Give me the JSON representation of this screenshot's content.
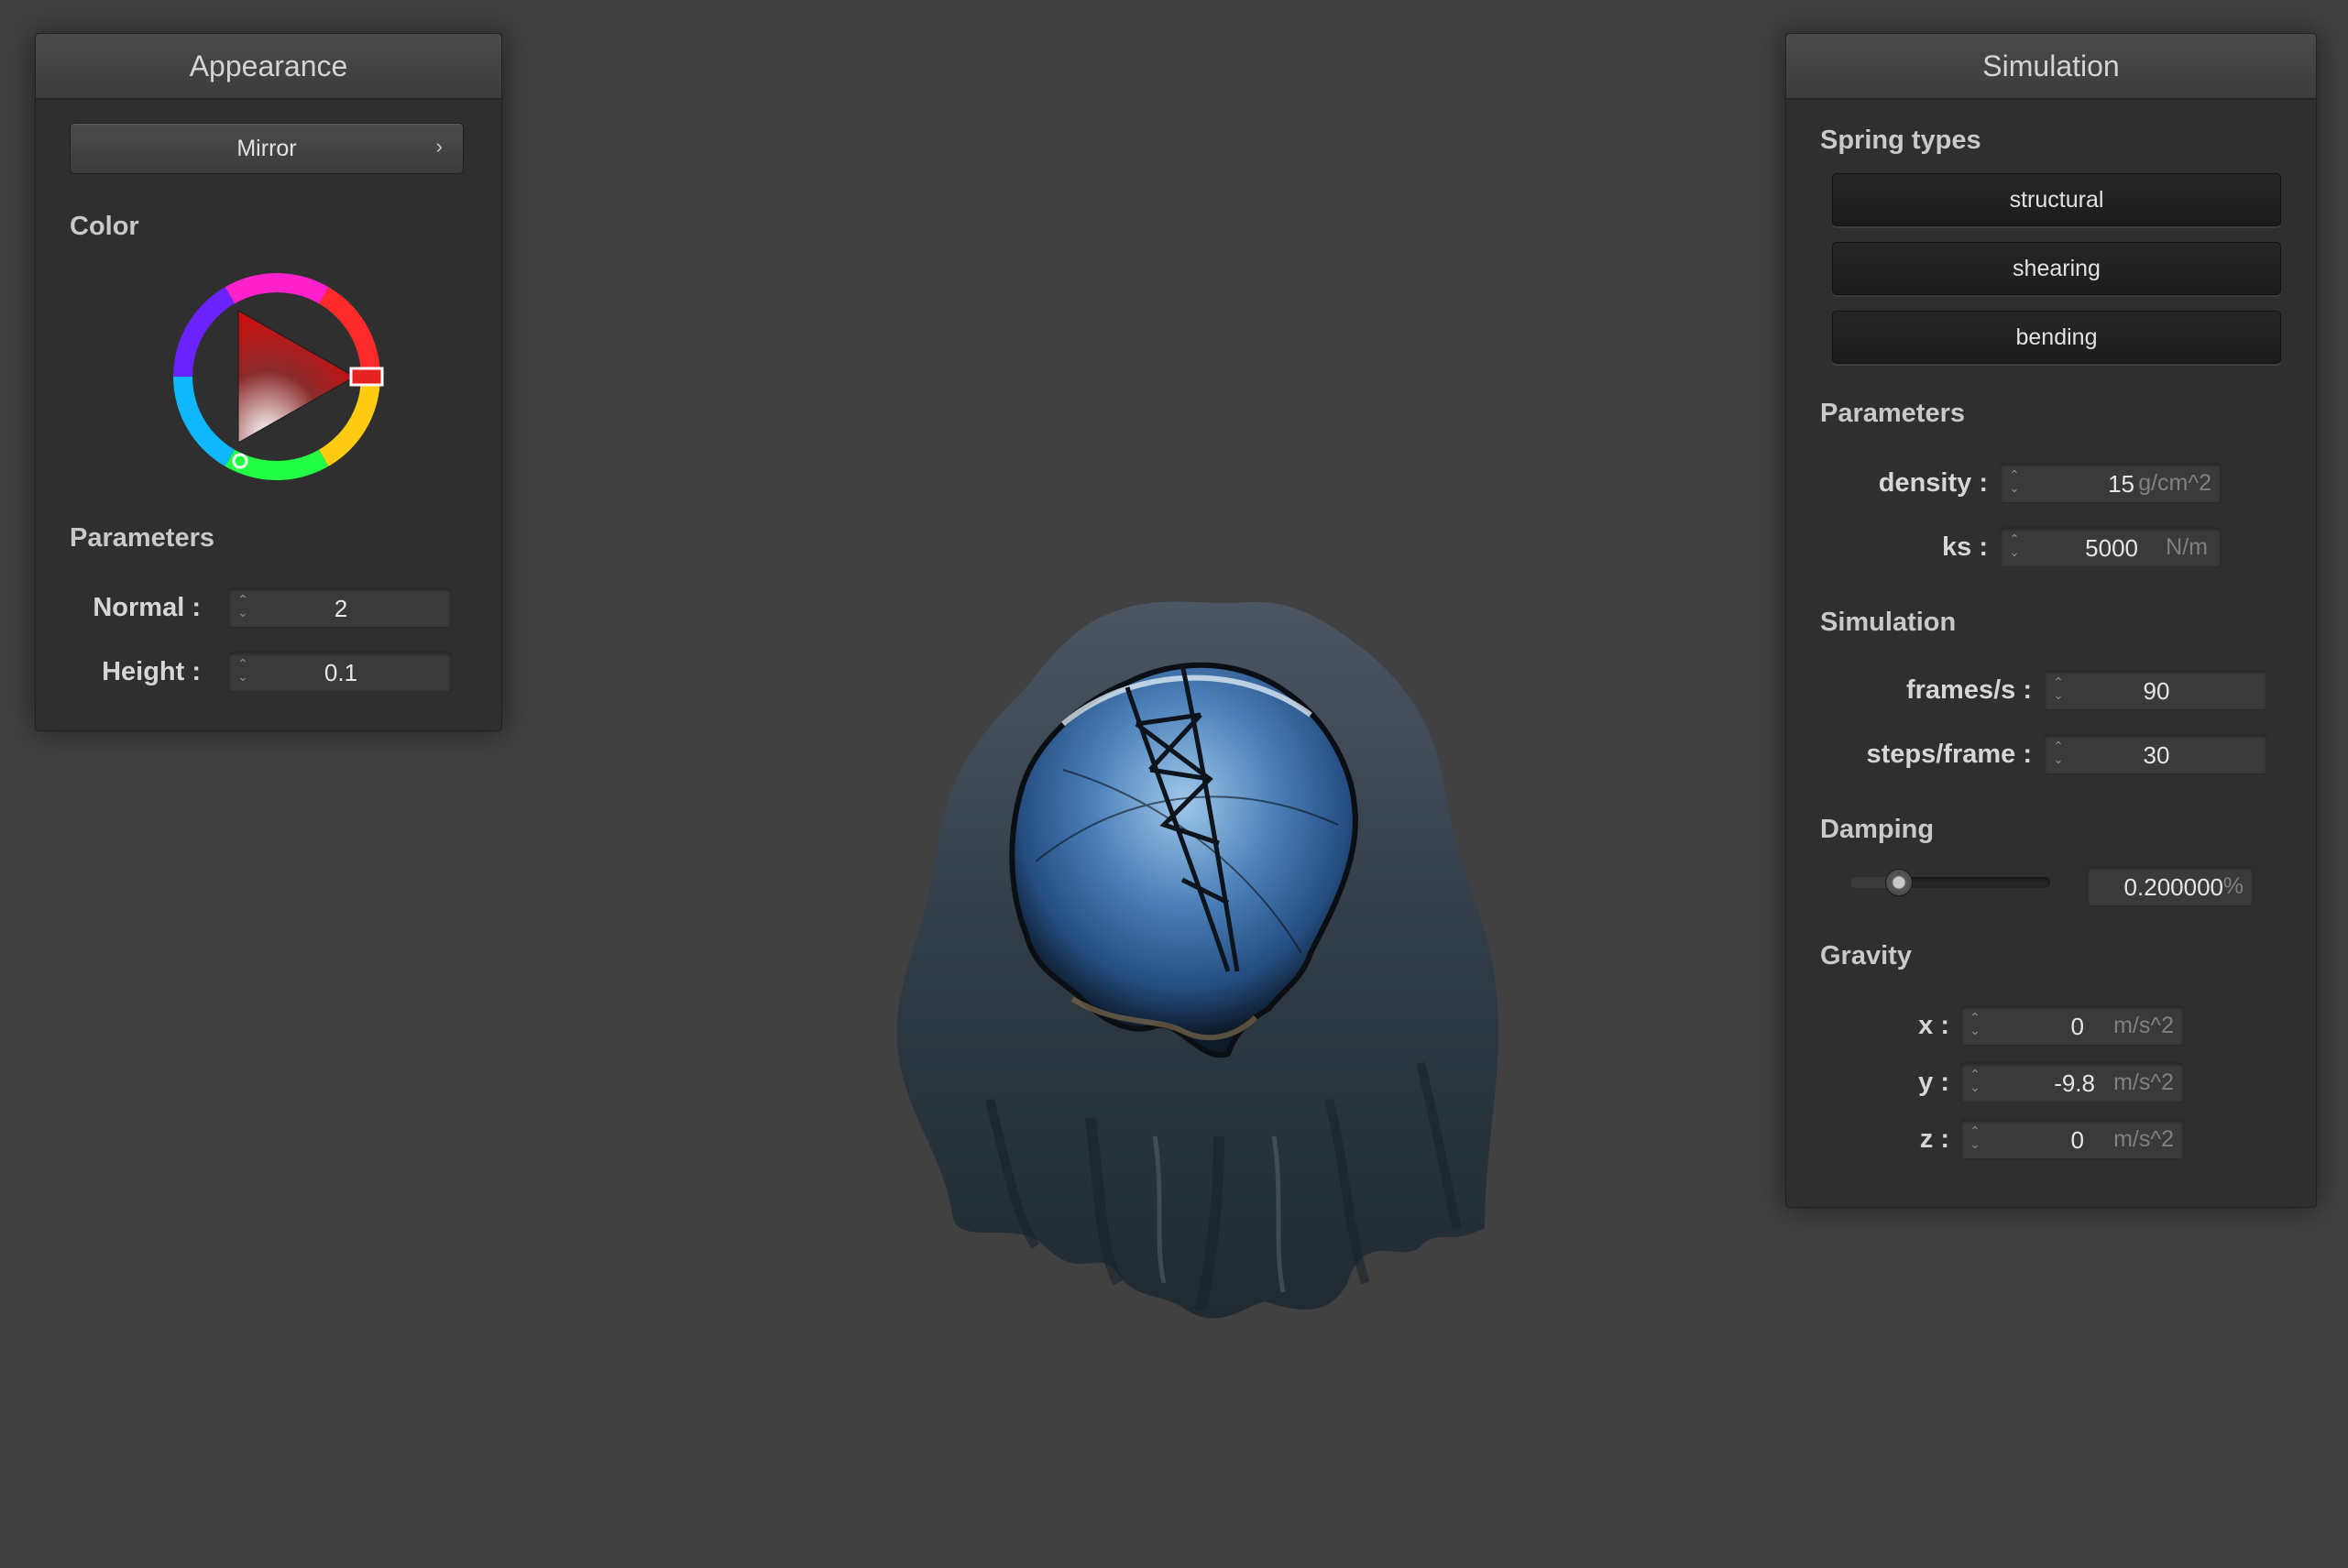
{
  "appearance": {
    "title": "Appearance",
    "shader_button": "Mirror",
    "color_label": "Color",
    "parameters_label": "Parameters",
    "normal": {
      "label": "Normal :",
      "value": "2"
    },
    "height": {
      "label": "Height :",
      "value": "0.1"
    },
    "color_wheel": {
      "selected_hue": "#ff0000"
    }
  },
  "simulation": {
    "title": "Simulation",
    "spring_types_label": "Spring types",
    "spring_buttons": [
      "structural",
      "shearing",
      "bending"
    ],
    "parameters_label": "Parameters",
    "density": {
      "label": "density :",
      "value": "15",
      "unit": "g/cm^2"
    },
    "ks": {
      "label": "ks :",
      "value": "5000",
      "unit": "N/m"
    },
    "simulation_label": "Simulation",
    "frames": {
      "label": "frames/s :",
      "value": "90"
    },
    "steps": {
      "label": "steps/frame :",
      "value": "30"
    },
    "damping_label": "Damping",
    "damping": {
      "value": "0.200000",
      "unit": "%",
      "slider_fraction": 0.2
    },
    "gravity_label": "Gravity",
    "gx": {
      "label": "x :",
      "value": "0",
      "unit": "m/s^2"
    },
    "gy": {
      "label": "y :",
      "value": "-9.8",
      "unit": "m/s^2"
    },
    "gz": {
      "label": "z :",
      "value": "0",
      "unit": "m/s^2"
    }
  },
  "viewport": {
    "object": "mirror-cloth-on-sphere"
  },
  "icons": {
    "spinner": "up-down-arrows-icon",
    "submenu": "chevron-right-icon"
  }
}
